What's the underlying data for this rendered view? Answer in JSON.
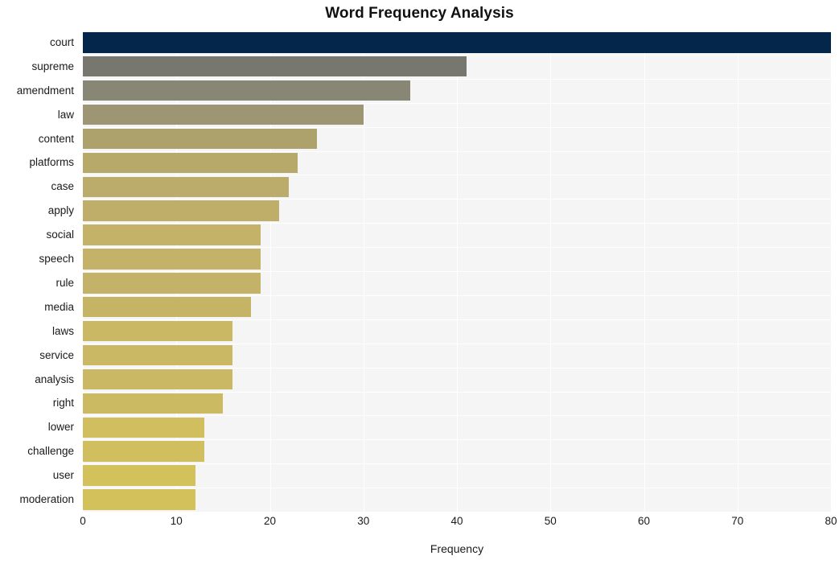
{
  "chart_data": {
    "type": "bar",
    "orientation": "horizontal",
    "title": "Word Frequency Analysis",
    "xlabel": "Frequency",
    "ylabel": "",
    "xlim": [
      0,
      80
    ],
    "xticks": [
      0,
      10,
      20,
      30,
      40,
      50,
      60,
      70,
      80
    ],
    "xtick_labels": [
      "0",
      "10",
      "20",
      "30",
      "40",
      "50",
      "60",
      "70",
      "80"
    ],
    "grid": true,
    "legend": null,
    "categories": [
      "court",
      "supreme",
      "amendment",
      "law",
      "content",
      "platforms",
      "case",
      "apply",
      "social",
      "speech",
      "rule",
      "media",
      "laws",
      "service",
      "analysis",
      "right",
      "lower",
      "challenge",
      "user",
      "moderation"
    ],
    "values": [
      80,
      41,
      35,
      30,
      25,
      23,
      22,
      21,
      19,
      19,
      19,
      18,
      16,
      16,
      16,
      15,
      13,
      13,
      12,
      12
    ],
    "bar_colors": [
      "#05264b",
      "#78776f",
      "#888675",
      "#9d9573",
      "#ada26b",
      "#b7a96a",
      "#bcac6c",
      "#bfae6a",
      "#c4b268",
      "#c4b268",
      "#c4b268",
      "#c6b466",
      "#cab865",
      "#cab865",
      "#cab865",
      "#ccba62",
      "#d0be5f",
      "#d0be5f",
      "#d3c15c",
      "#d3c15c"
    ],
    "plot_background": "#f5f5f5",
    "grid_color": "#ffffff",
    "figure_background": "#ffffff"
  },
  "axes": {
    "x_axis_name": "frequency-axis",
    "y_axis_name": "word-axis"
  }
}
